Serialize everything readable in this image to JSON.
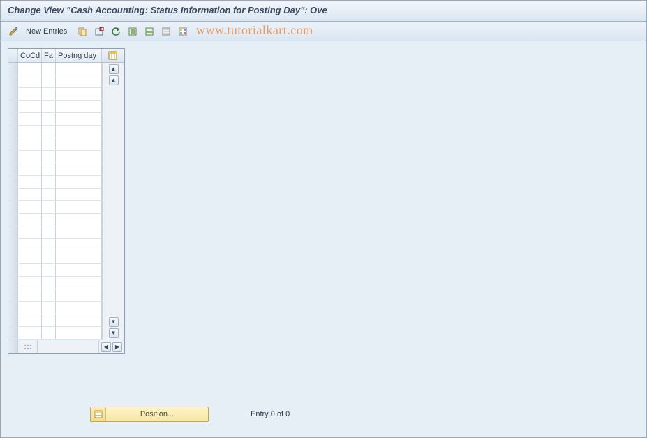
{
  "title": "Change View \"Cash Accounting: Status Information for Posting Day\": Ove",
  "toolbar": {
    "new_entries_label": "New Entries"
  },
  "watermark": "www.tutorialkart.com",
  "grid": {
    "columns": [
      "CoCd",
      "Fa",
      "Postng day"
    ],
    "row_count": 22
  },
  "position_button_label": "Position...",
  "entry_status": "Entry 0 of 0"
}
